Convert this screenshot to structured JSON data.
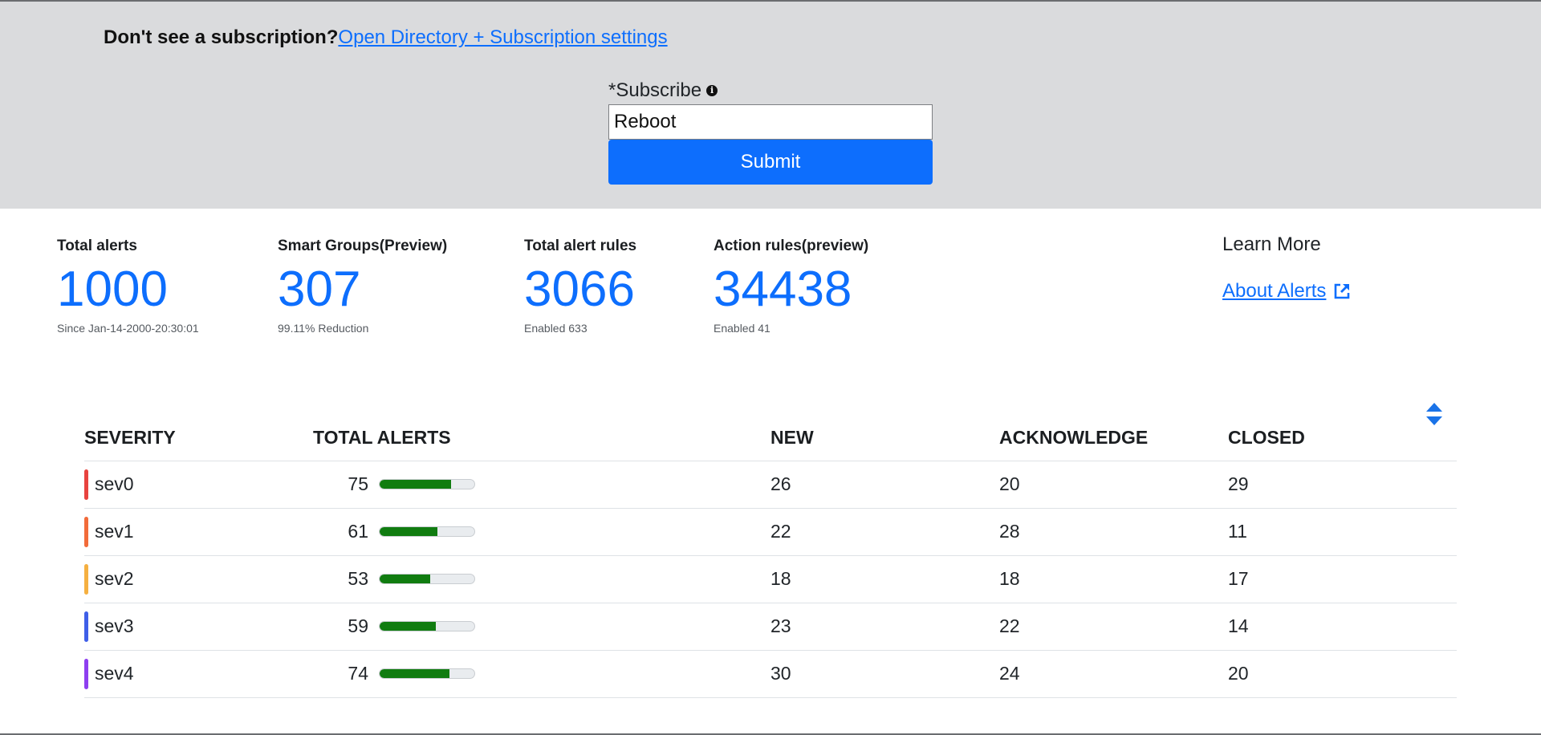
{
  "subscription": {
    "question": "Don't see a subscription?",
    "link_label": "Open Directory + Subscription settings"
  },
  "subscribe_form": {
    "label": "*Subscribe",
    "info_icon": "info-circle",
    "input_value": "Reboot",
    "submit_label": "Submit"
  },
  "stats": [
    {
      "label": "Total alerts",
      "value": "1000",
      "sub": "Since Jan-14-2000-20:30:01"
    },
    {
      "label": "Smart Groups(Preview)",
      "value": "307",
      "sub": "99.11% Reduction"
    },
    {
      "label": "Total alert rules",
      "value": "3066",
      "sub": "Enabled 633"
    },
    {
      "label": "Action rules(preview)",
      "value": "34438",
      "sub": "Enabled 41"
    }
  ],
  "learn_more": {
    "title": "Learn More",
    "link_label": "About Alerts",
    "link_icon": "external-link"
  },
  "table": {
    "sort_icon": "sort-up-down",
    "headers": [
      "SEVERITY",
      "TOTAL ALERTS",
      "NEW",
      "ACKNOWLEDGE",
      "CLOSED"
    ],
    "bar_max": 100,
    "rows": [
      {
        "severity": "sev0",
        "color": "#e8433f",
        "total": "75",
        "total_value": 75,
        "new": "26",
        "acknowledge": "20",
        "closed": "29"
      },
      {
        "severity": "sev1",
        "color": "#f26b3a",
        "total": "61",
        "total_value": 61,
        "new": "22",
        "acknowledge": "28",
        "closed": "11"
      },
      {
        "severity": "sev2",
        "color": "#f5b041",
        "total": "53",
        "total_value": 53,
        "new": "18",
        "acknowledge": "18",
        "closed": "17"
      },
      {
        "severity": "sev3",
        "color": "#3f5fe8",
        "total": "59",
        "total_value": 59,
        "new": "23",
        "acknowledge": "22",
        "closed": "14"
      },
      {
        "severity": "sev4",
        "color": "#8e3ff0",
        "total": "74",
        "total_value": 74,
        "new": "30",
        "acknowledge": "24",
        "closed": "20"
      }
    ]
  },
  "colors": {
    "accent": "#0d6efd",
    "bar_fill": "#107c10",
    "top_band": "#dadbdd"
  }
}
